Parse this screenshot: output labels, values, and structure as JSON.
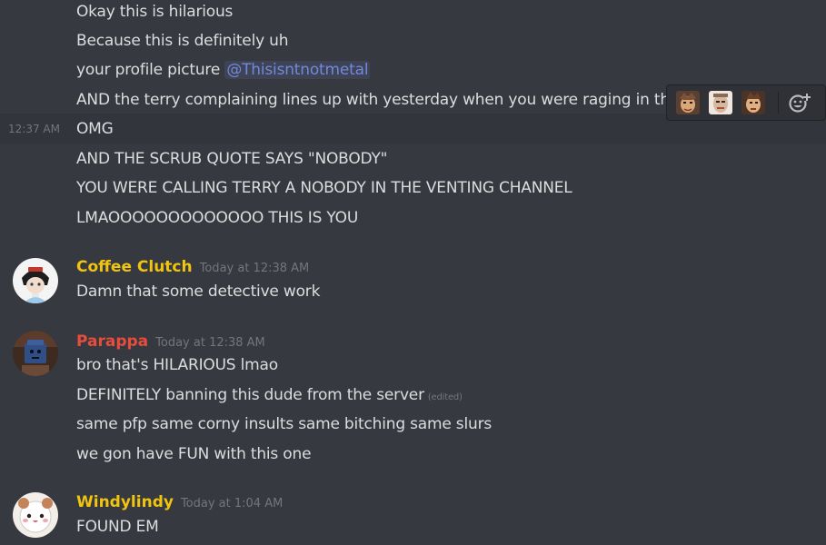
{
  "colors": {
    "background": "#36393f",
    "hover_row": "#32353b",
    "text": "#dcddde",
    "muted": "#72767d",
    "mention": "#7289da",
    "coffee_clutch": "#f1c40f",
    "parappa": "#e74c3c",
    "windylindy": "#f1c40f"
  },
  "first_group": {
    "lines": [
      "Okay this is hilarious",
      "Because this is definitely uh",
      "your profile picture ",
      "AND the terry complaining lines up with yesterday when you were raging in th",
      "OMG",
      "AND THE SCRUB QUOTE SAYS \"NOBODY\"",
      "YOU WERE CALLING TERRY A NOBODY IN THE VENTING CHANNEL",
      "LMAOOOOOOOOOOOOO THIS IS YOU"
    ],
    "mention": "@Thisisntnotmetal",
    "hover_timestamp": "12:37 AM"
  },
  "hover_toolbar": {
    "emojis": [
      "terry-face-1",
      "terry-face-2",
      "terry-face-3"
    ],
    "add_reaction_icon": "add-reaction-icon"
  },
  "messages": [
    {
      "username": "Coffee Clutch",
      "time": "Today at 12:38 AM",
      "lines": [
        "Damn that some detective work"
      ]
    },
    {
      "username": "Parappa",
      "time": "Today at 12:38 AM",
      "lines": [
        "bro that's HILARIOUS lmao",
        "DEFINITELY banning this dude from the server",
        "same pfp same corny insults same bitching same slurs",
        "we gon have FUN with this one"
      ],
      "edited": "(edited)"
    },
    {
      "username": "Windylindy",
      "time": "Today at 1:04 AM",
      "lines": [
        "FOUND EM"
      ]
    }
  ]
}
